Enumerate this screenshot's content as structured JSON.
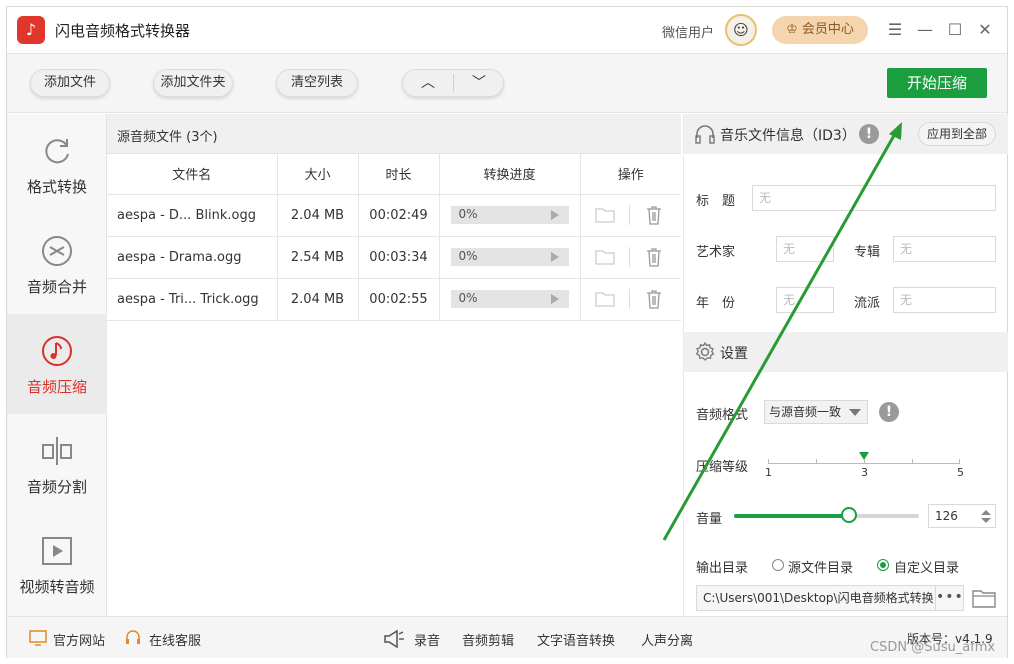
{
  "app": {
    "title": "闪电音频格式转换器",
    "user_name": "微信用户",
    "vip_label": "会员中心",
    "avatar_glyph": "☺"
  },
  "toolbar": {
    "add_file": "添加文件",
    "add_folder": "添加文件夹",
    "clear_list": "清空列表",
    "move_up": "︿",
    "move_down": "﹀",
    "start": "开始压缩"
  },
  "sidebar": {
    "items": [
      {
        "label": "格式转换",
        "icon": "refresh-icon",
        "active": false
      },
      {
        "label": "音频合并",
        "icon": "merge-icon",
        "active": false
      },
      {
        "label": "音频压缩",
        "icon": "music-note-icon",
        "active": true
      },
      {
        "label": "音频分割",
        "icon": "split-icon",
        "active": false
      },
      {
        "label": "视频转音频",
        "icon": "video-play-icon",
        "active": false
      }
    ]
  },
  "file_list": {
    "title": "源音频文件 (3个)",
    "columns": [
      "文件名",
      "大小",
      "时长",
      "转换进度",
      "操作"
    ],
    "rows": [
      {
        "name": "aespa - D... Blink.ogg",
        "size": "2.04 MB",
        "duration": "00:02:49",
        "progress": "0%"
      },
      {
        "name": "aespa - Drama.ogg",
        "size": "2.54 MB",
        "duration": "00:03:34",
        "progress": "0%"
      },
      {
        "name": "aespa - Tri... Trick.ogg",
        "size": "2.04 MB",
        "duration": "00:02:55",
        "progress": "0%"
      }
    ]
  },
  "music_info": {
    "title": "音乐文件信息（ID3）",
    "info_glyph": "!",
    "apply_all": "应用到全部",
    "title_label": "标　题",
    "artist_label": "艺术家",
    "album_label": "专辑",
    "year_label": "年　份",
    "genre_label": "流派",
    "empty_placeholder": "无"
  },
  "settings": {
    "title": "设置",
    "format_label": "音频格式",
    "format_value": "与源音频一致",
    "level_label": "压缩等级",
    "level_min": "1",
    "level_mid": "3",
    "level_max": "5",
    "level_value": 3,
    "volume_label": "音量",
    "volume_value": "126",
    "volume_fraction": 0.62,
    "output_label": "输出目录",
    "output_source": "源文件目录",
    "output_custom": "自定义目录",
    "output_selected": "custom",
    "output_path": "C:\\Users\\001\\Desktop\\闪电音频格式转换",
    "path_more": "•••"
  },
  "footer": {
    "website": "官方网站",
    "support": "在线客服",
    "record": "录音",
    "audio_edit": "音频剪辑",
    "tts": "文字语音转换",
    "vocal_split": "人声分离",
    "version": "版本号：v4.1.9"
  },
  "watermark": "CSDN @Susu_afmx",
  "colors": {
    "accent": "#1a9e3f",
    "active_red": "#d9322b",
    "vip_bg": "#f5d5ad"
  }
}
